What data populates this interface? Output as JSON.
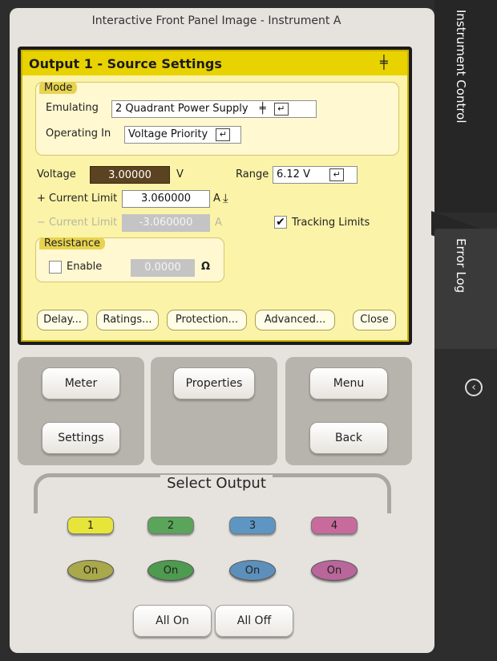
{
  "window": {
    "title": "Interactive Front Panel Image - Instrument A"
  },
  "side_tabs": [
    {
      "label": "Instrument Control"
    },
    {
      "label": "Error Log"
    }
  ],
  "collapse_icon": "chevron-left-icon",
  "dialog": {
    "title": "Output 1 - Source Settings",
    "mode": {
      "group_label": "Mode",
      "emulating_label": "Emulating",
      "emulating_value": "2 Quadrant Power Supply",
      "operating_label": "Operating In",
      "operating_value": "Voltage Priority"
    },
    "voltage_label": "Voltage",
    "voltage_value": "3.00000",
    "voltage_unit": "V",
    "range_label": "Range",
    "range_value": "6.12 V",
    "pos_current_label": "+ Current Limit",
    "pos_current_value": "3.060000",
    "pos_current_unit": "A",
    "neg_current_label": "− Current Limit",
    "neg_current_value": "-3.060000",
    "neg_current_unit": "A",
    "tracking_label": "Tracking Limits",
    "tracking_checked": true,
    "resistance": {
      "group_label": "Resistance",
      "enable_label": "Enable",
      "enabled": false,
      "value": "0.0000",
      "unit": "Ω"
    },
    "buttons": {
      "delay": "Delay...",
      "ratings": "Ratings...",
      "protection": "Protection...",
      "advanced": "Advanced...",
      "close": "Close"
    }
  },
  "nav": {
    "meter": "Meter",
    "settings": "Settings",
    "properties": "Properties",
    "menu": "Menu",
    "back": "Back"
  },
  "select_output": {
    "title": "Select Output",
    "outputs": [
      {
        "label": "1",
        "color": "#e7e43a",
        "on_label": "On",
        "on_color": "#a9a84a"
      },
      {
        "label": "2",
        "color": "#5aa55a",
        "on_label": "On",
        "on_color": "#4e9a4e"
      },
      {
        "label": "3",
        "color": "#5d96c3",
        "on_label": "On",
        "on_color": "#5d8fbb"
      },
      {
        "label": "4",
        "color": "#c86a9c",
        "on_label": "On",
        "on_color": "#b9669a"
      }
    ],
    "all_on": "All On",
    "all_off": "All Off"
  }
}
